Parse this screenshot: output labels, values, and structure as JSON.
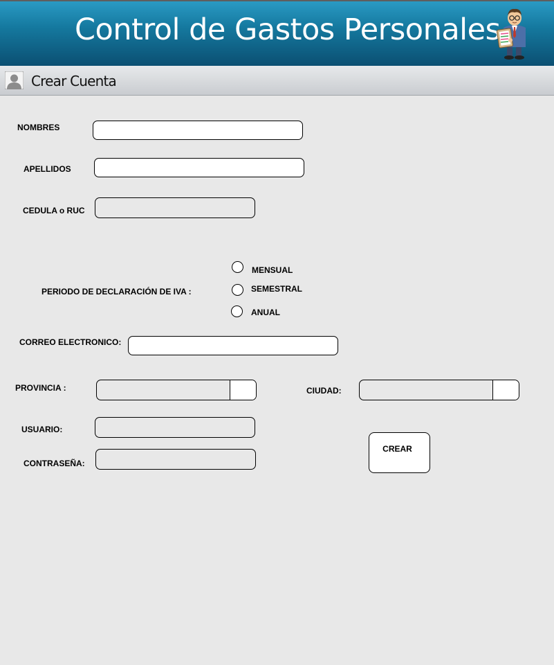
{
  "header": {
    "title": "Control de Gastos Personales",
    "mascot_icon": "businessman-clipboard-icon"
  },
  "subheader": {
    "icon": "user-icon",
    "title": "Crear Cuenta"
  },
  "form": {
    "nombres_label": "NOMBRES",
    "apellidos_label": "APELLIDOS",
    "cedula_label": "CEDULA o RUC",
    "periodo_label": "PERIODO DE DECLARACIÓN DE IVA :",
    "periodo_options": [
      "MENSUAL",
      "SEMESTRAL",
      "ANUAL"
    ],
    "correo_label": "CORREO ELECTRONICO:",
    "provincia_label": "PROVINCIA :",
    "ciudad_label": "CIUDAD:",
    "usuario_label": "USUARIO:",
    "contrasena_label": "CONTRASEÑA:",
    "crear_button": "CREAR"
  },
  "colors": {
    "header_top": "#2a9ac4",
    "header_bottom": "#0b4f72",
    "page_background": "#e8e8e8"
  }
}
